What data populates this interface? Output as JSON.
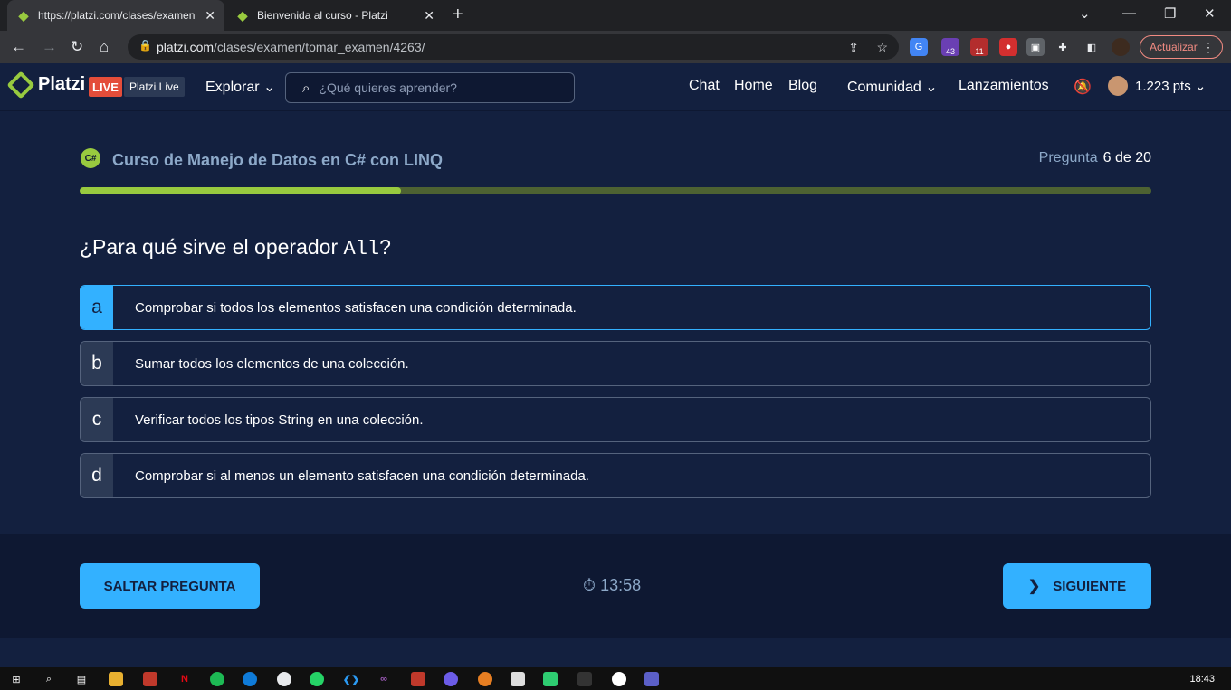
{
  "browser": {
    "tabs": [
      {
        "title": "https://platzi.com/clases/examen",
        "active": true
      },
      {
        "title": "Bienvenida al curso - Platzi",
        "active": false
      }
    ],
    "url_host": "platzi.com",
    "url_path": "/clases/examen/tomar_examen/4263/",
    "update_label": "Actualizar",
    "ext_badges": {
      "a": "43",
      "b": "11"
    }
  },
  "nav": {
    "logo": "Platzi",
    "live_badge": "LIVE",
    "platzi_live": "Platzi Live",
    "explorar": "Explorar",
    "search_placeholder": "¿Qué quieres aprender?",
    "links": {
      "chat": "Chat",
      "home": "Home",
      "blog": "Blog",
      "comunidad": "Comunidad",
      "lanzamientos": "Lanzamientos"
    },
    "points": "1.223 pts"
  },
  "exam": {
    "course_title": "Curso de Manejo de Datos en C# con LINQ",
    "question_label": "Pregunta",
    "question_count": "6 de 20",
    "progress": 0.3,
    "question_prefix": "¿Para qué sirve el operador ",
    "question_code": "All",
    "question_suffix": "?",
    "options": [
      {
        "letter": "a",
        "text": "Comprobar si todos los elementos satisfacen una condición determinada.",
        "selected": true
      },
      {
        "letter": "b",
        "text": "Sumar todos los elementos de una colección.",
        "selected": false
      },
      {
        "letter": "c",
        "text": "Verificar todos los tipos String en una colección.",
        "selected": false
      },
      {
        "letter": "d",
        "text": "Comprobar si al menos un elemento satisfacen una condición determinada.",
        "selected": false
      }
    ],
    "skip_label": "SALTAR PREGUNTA",
    "next_label": "SIGUIENTE",
    "timer": "13:58"
  },
  "taskbar": {
    "clock": "18:43"
  },
  "colors": {
    "accent": "#33b1ff",
    "green": "#98ca3f",
    "bg": "#13203f"
  }
}
